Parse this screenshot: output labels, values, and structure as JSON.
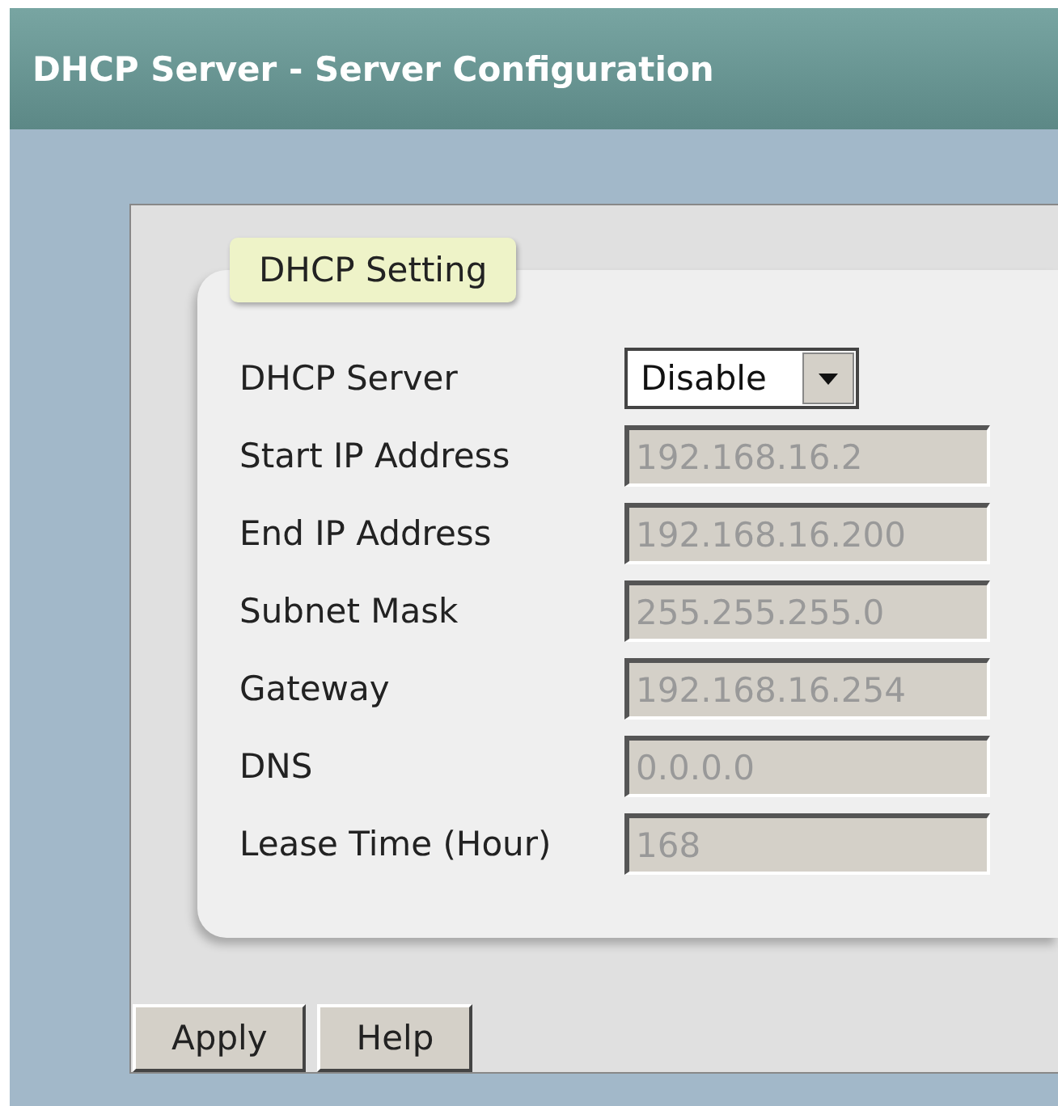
{
  "header": {
    "title": "DHCP Server - Server Configuration"
  },
  "group": {
    "legend": "DHCP Setting"
  },
  "fields": [
    {
      "label": "DHCP Server",
      "kind": "select",
      "value": "Disable",
      "disabled": false
    },
    {
      "label": "Start IP Address",
      "kind": "text",
      "value": "192.168.16.2",
      "disabled": true
    },
    {
      "label": "End IP Address",
      "kind": "text",
      "value": "192.168.16.200",
      "disabled": true
    },
    {
      "label": "Subnet Mask",
      "kind": "text",
      "value": "255.255.255.0",
      "disabled": true
    },
    {
      "label": "Gateway",
      "kind": "text",
      "value": "192.168.16.254",
      "disabled": true
    },
    {
      "label": "DNS",
      "kind": "text",
      "value": "0.0.0.0",
      "disabled": true
    },
    {
      "label": "Lease Time (Hour)",
      "kind": "text",
      "value": "168",
      "disabled": true
    }
  ],
  "buttons": [
    "Apply",
    "Help"
  ]
}
